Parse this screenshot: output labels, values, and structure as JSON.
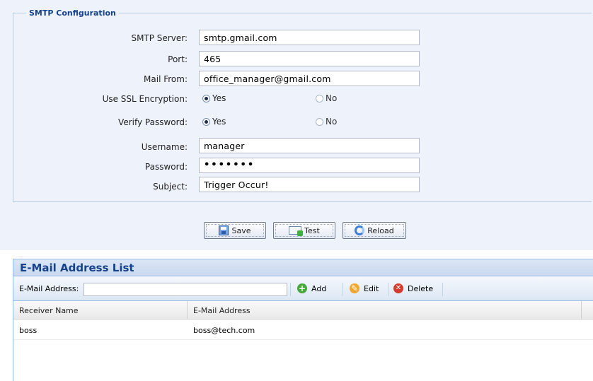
{
  "smtp": {
    "legend": "SMTP Configuration",
    "fields": {
      "server": {
        "label": "SMTP Server:",
        "value": "smtp.gmail.com"
      },
      "port": {
        "label": "Port:",
        "value": "465"
      },
      "mail_from": {
        "label": "Mail From:",
        "value": "office_manager@gmail.com"
      },
      "ssl": {
        "label": "Use SSL Encryption:",
        "yes": "Yes",
        "no": "No",
        "selected": "Yes"
      },
      "verify": {
        "label": "Verify Password:",
        "yes": "Yes",
        "no": "No",
        "selected": "Yes"
      },
      "username": {
        "label": "Username:",
        "value": "manager"
      },
      "password": {
        "label": "Password:",
        "value": "•••••••"
      },
      "subject": {
        "label": "Subject:",
        "value": "Trigger Occur!"
      }
    },
    "buttons": {
      "save": "Save",
      "test": "Test",
      "reload": "Reload"
    }
  },
  "email_list": {
    "title": "E-Mail Address List",
    "toolbar": {
      "label": "E-Mail Address:",
      "input_value": "",
      "add": "Add",
      "edit": "Edit",
      "delete": "Delete"
    },
    "columns": [
      "Receiver Name",
      "E-Mail Address"
    ],
    "rows": [
      [
        "boss",
        "boss@tech.com"
      ]
    ]
  },
  "icons": {
    "save": "floppy-disk-icon",
    "test": "mail-send-icon",
    "reload": "reload-icon",
    "add": "add-circle-icon",
    "edit": "edit-circle-icon",
    "delete": "delete-circle-icon"
  },
  "colors": {
    "panel_bg": "#eef3fb",
    "title_text": "#15428b",
    "border": "#99bbe8"
  }
}
